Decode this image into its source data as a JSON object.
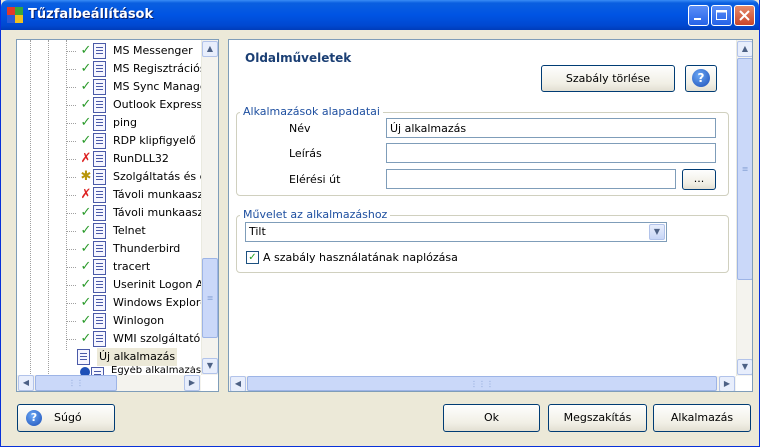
{
  "window": {
    "title": "Tűzfalbeállítások"
  },
  "tree": {
    "items": [
      {
        "status": "ok",
        "label": "MS Messenger"
      },
      {
        "status": "ok",
        "label": "MS Regisztrációs v"
      },
      {
        "status": "ok",
        "label": "MS Sync Manager"
      },
      {
        "status": "ok",
        "label": "Outlook Express"
      },
      {
        "status": "ok",
        "label": "ping"
      },
      {
        "status": "ok",
        "label": "RDP klipfigyelő"
      },
      {
        "status": "x",
        "label": "RunDLL32"
      },
      {
        "status": "gear",
        "label": "Szolgáltatás és elle"
      },
      {
        "status": "x",
        "label": "Távoli munkaaszta"
      },
      {
        "status": "ok",
        "label": "Távoli munkaaszta"
      },
      {
        "status": "ok",
        "label": "Telnet"
      },
      {
        "status": "ok",
        "label": "Thunderbird"
      },
      {
        "status": "ok",
        "label": "tracert"
      },
      {
        "status": "ok",
        "label": "Userinit Logon App"
      },
      {
        "status": "ok",
        "label": "Windows Explorer"
      },
      {
        "status": "ok",
        "label": "Winlogon"
      },
      {
        "status": "ok",
        "label": "WMI szolgáltató ki"
      }
    ],
    "selected_label": "Új alkalmazás",
    "partial_label": "Egyéb alkalmazás"
  },
  "panel": {
    "title": "Oldalműveletek",
    "delete_rule_label": "Szabály törlése",
    "help_icon": "?"
  },
  "app_basics": {
    "group_title": "Alkalmazások alapadatai",
    "name_label": "Név",
    "name_value": "Új alkalmazás",
    "desc_label": "Leírás",
    "desc_value": "",
    "path_label": "Elérési út",
    "path_value": "",
    "browse_label": "..."
  },
  "action": {
    "group_title": "Művelet az alkalmazáshoz",
    "selected_option": "Tilt",
    "log_checkbox_label": "A szabály használatának naplózása",
    "log_checked": true
  },
  "footer": {
    "help_label": "Súgó",
    "ok_label": "Ok",
    "cancel_label": "Megszakítás",
    "apply_label": "Alkalmazás"
  },
  "colors": {
    "titlebar": "#0054e3",
    "accent_ok": "#2a9a2a",
    "accent_error": "#dd2222"
  }
}
